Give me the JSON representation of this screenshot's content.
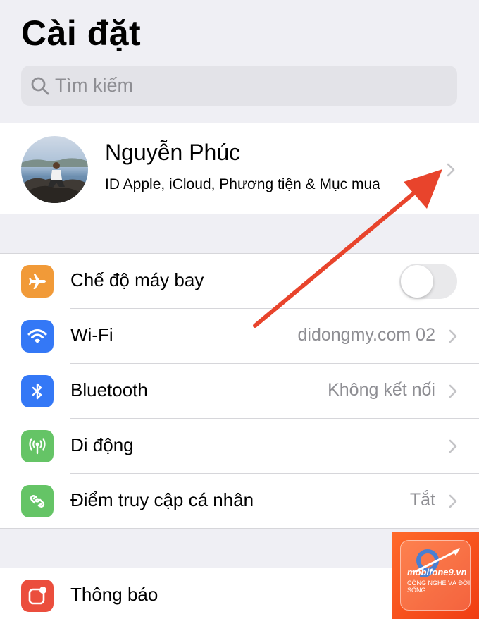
{
  "header": {
    "title": "Cài đặt"
  },
  "search": {
    "placeholder": "Tìm kiếm"
  },
  "profile": {
    "name": "Nguyễn Phúc",
    "subtitle": "ID Apple, iCloud, Phương tiện & Mục mua"
  },
  "settings": [
    {
      "label": "Chế độ máy bay",
      "icon": "airplane-icon",
      "color": "#f19a38",
      "toggle": false
    },
    {
      "label": "Wi-Fi",
      "value": "didongmy.com 02",
      "icon": "wifi-icon",
      "color": "#3478f6"
    },
    {
      "label": "Bluetooth",
      "value": "Không kết nối",
      "icon": "bluetooth-icon",
      "color": "#3478f6"
    },
    {
      "label": "Di động",
      "value": "",
      "icon": "cellular-icon",
      "color": "#65c466"
    },
    {
      "label": "Điểm truy cập cá nhân",
      "value": "Tắt",
      "icon": "hotspot-icon",
      "color": "#65c466"
    },
    {
      "label": "Thông báo",
      "icon": "notifications-icon",
      "color": "#eb4e3d"
    }
  ],
  "watermark": {
    "brand": "mobifone9",
    "domain": ".vn",
    "tagline": "CÔNG NGHỆ VÀ ĐỜI SỐNG"
  },
  "annotation": {
    "arrow_color": "#e8442c"
  }
}
